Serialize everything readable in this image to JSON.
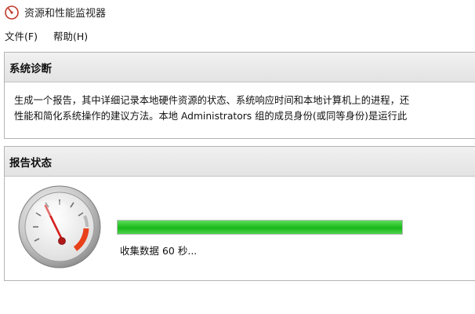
{
  "window": {
    "title": "资源和性能监视器"
  },
  "menu": {
    "items": [
      {
        "label": "文件(F)"
      },
      {
        "label": "帮助(H)"
      }
    ]
  },
  "diagnostics": {
    "title": "系统诊断",
    "lines": [
      "生成一个报告，其中详细记录本地硬件资源的状态、系统响应时间和本地计算机上的进程，还",
      "性能和简化系统操作的建议方法。本地 Administrators 组的成员身份(或同等身份)是运行此"
    ]
  },
  "report_status": {
    "title": "报告状态",
    "progress_fraction": 1.0,
    "progress_text": "收集数据 60 秒..."
  },
  "icons": {
    "app": "gauge-icon",
    "status": "speedometer-icon"
  },
  "colors": {
    "progress": "#1bb71b",
    "gauge_needle": "#d42020",
    "gauge_redzone": "#e8401a"
  }
}
